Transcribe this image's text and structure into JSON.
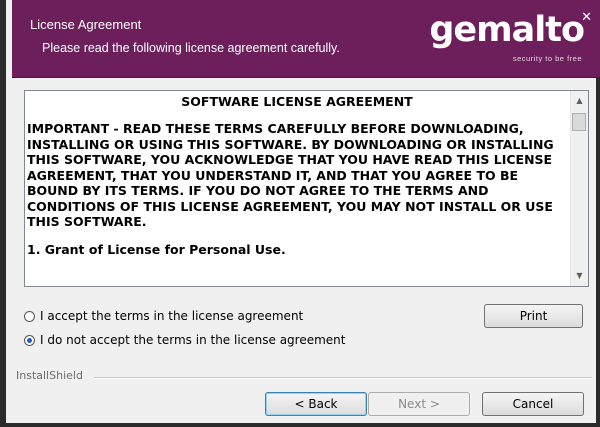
{
  "header": {
    "title": "License Agreement",
    "subtitle": "Please read the following license agreement carefully.",
    "logo_text": "gemalto",
    "logo_tagline": "security to be free",
    "brand_color": "#6d1f5c"
  },
  "license": {
    "title": "SOFTWARE LICENSE AGREEMENT",
    "paragraph": "IMPORTANT - READ THESE TERMS CAREFULLY BEFORE DOWNLOADING, INSTALLING OR USING THIS SOFTWARE. BY DOWNLOADING OR INSTALLING THIS SOFTWARE, YOU ACKNOWLEDGE THAT YOU HAVE READ THIS LICENSE AGREEMENT, THAT YOU UNDERSTAND IT, AND THAT YOU AGREE TO BE BOUND BY ITS TERMS. IF YOU DO NOT AGREE TO THE TERMS AND CONDITIONS OF THIS LICENSE AGREEMENT, YOU MAY NOT INSTALL OR USE THIS SOFTWARE.",
    "section1": "1. Grant of License for Personal Use."
  },
  "options": {
    "accept": "I accept the terms in the license agreement",
    "decline": "I do not accept the terms in the license agreement",
    "selected": "decline"
  },
  "buttons": {
    "print": "Print",
    "back": "< Back",
    "next": "Next >",
    "cancel": "Cancel"
  },
  "footer": {
    "installshield": "InstallShield"
  }
}
